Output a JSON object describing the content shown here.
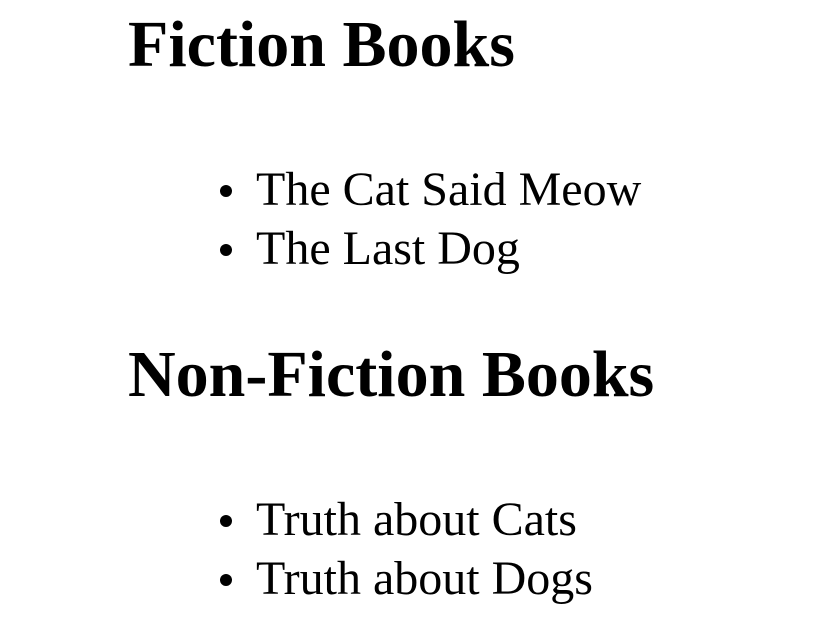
{
  "sections": [
    {
      "heading": "Fiction Books",
      "items": [
        "The Cat Said Meow",
        "The Last Dog"
      ]
    },
    {
      "heading": "Non-Fiction Books",
      "items": [
        "Truth about Cats",
        "Truth about Dogs"
      ]
    }
  ]
}
